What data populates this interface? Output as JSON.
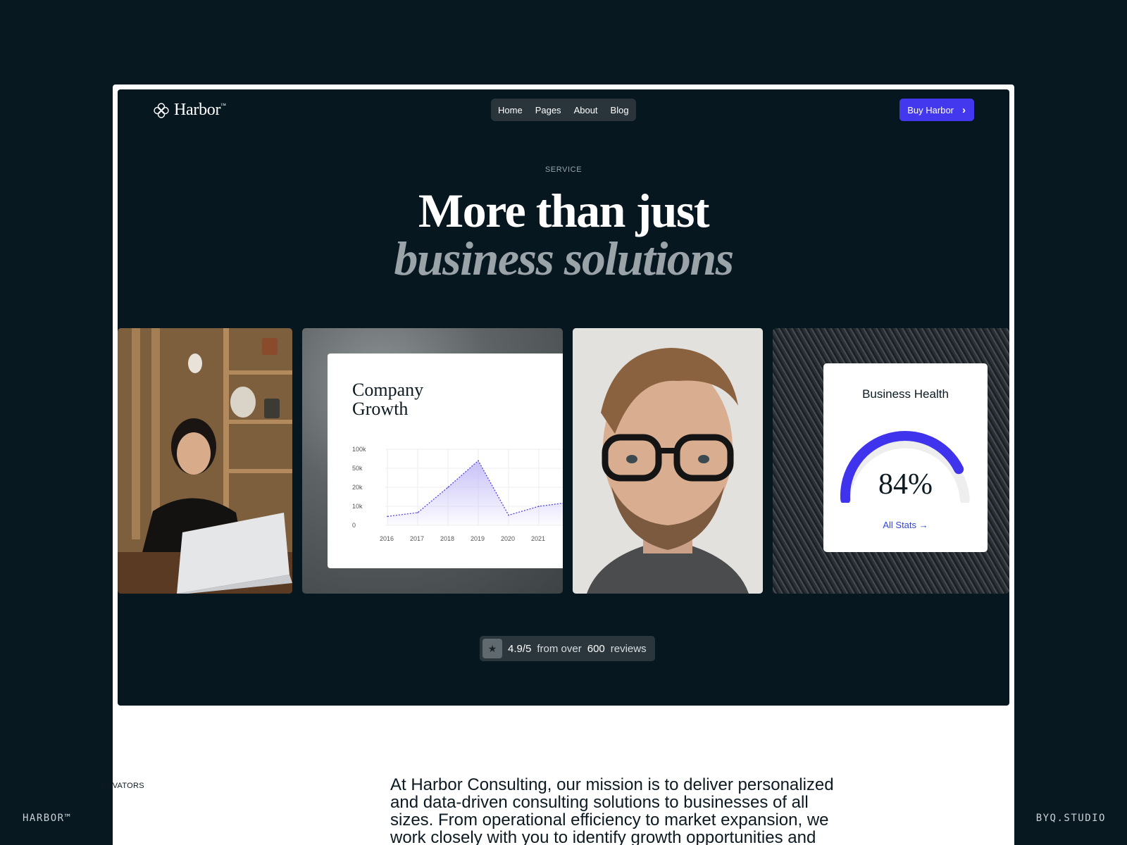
{
  "corner_left": "HARBOR™",
  "corner_right": "BYQ.STUDIO",
  "brand": {
    "name": "Harbor",
    "tm": "™"
  },
  "nav": {
    "items": [
      "Home",
      "Pages",
      "About",
      "Blog"
    ]
  },
  "cta": {
    "label": "Buy Harbor"
  },
  "hero": {
    "eyebrow": "SERVICE",
    "line1": "More than just",
    "line2": "business solutions"
  },
  "growth_card": {
    "title_line1": "Company",
    "title_line2": "Growth"
  },
  "chart_data": {
    "type": "area",
    "title": "Company Growth",
    "x": [
      "2016",
      "2017",
      "2018",
      "2019",
      "2020",
      "2021"
    ],
    "y_ticks": [
      "100k",
      "50k",
      "20k",
      "10k",
      "0"
    ],
    "series": [
      {
        "values": [
          7,
          10,
          30,
          51,
          8,
          15
        ]
      }
    ],
    "colors": {
      "line": "#5145e6",
      "fill": "#c4bdf7"
    }
  },
  "health": {
    "title": "Business Health",
    "value": "84%",
    "percent": 84,
    "link": "All Stats →",
    "colors": {
      "arc": "#4033ee",
      "track": "#eeeeee"
    }
  },
  "rating": {
    "score": "4.9/5",
    "middle": "from over",
    "count": "600",
    "suffix": "reviews"
  },
  "section2": {
    "eyebrow": "PASSIONATE INNOVATORS",
    "text": "At Harbor Consulting, our mission is to deliver personalized and data-driven consulting solutions to businesses of all sizes. From operational efficiency to market expansion, we work closely with you to identify growth opportunities and"
  }
}
